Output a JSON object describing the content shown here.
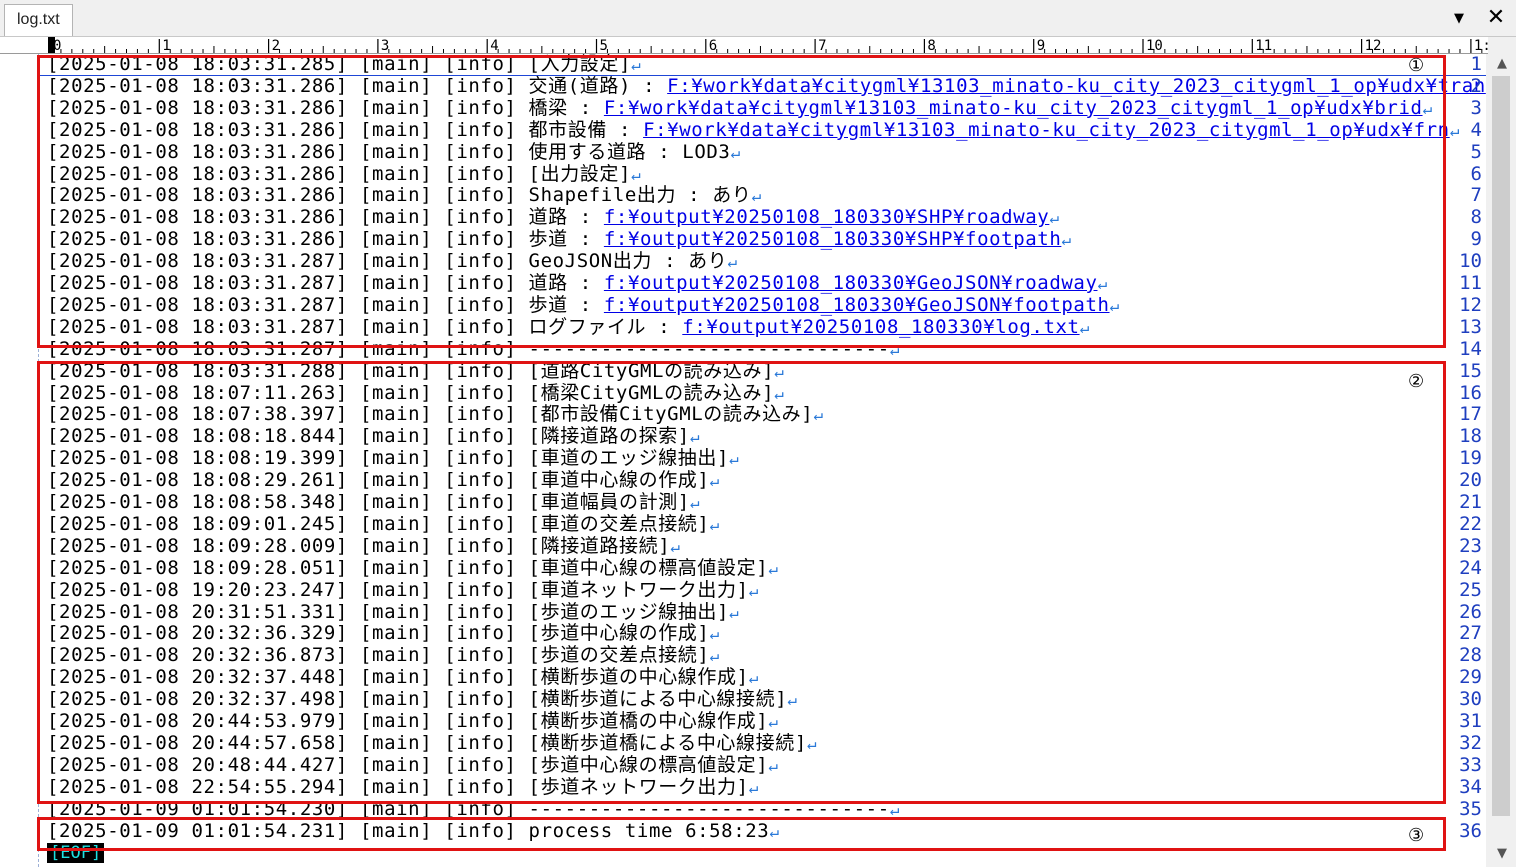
{
  "tab": {
    "label": "log.txt"
  },
  "window": {
    "dropdown_icon": "chevron-down-icon",
    "close_icon": "close-icon",
    "dropdown_glyph": "▼",
    "close_glyph": "✕"
  },
  "ruler": {
    "labels": [
      "0",
      "1",
      "2",
      "3",
      "4",
      "5",
      "6",
      "7",
      "8",
      "9",
      "10",
      "11",
      "12",
      "1:"
    ]
  },
  "return_glyph": "↵",
  "lines": [
    {
      "n": "1",
      "text": "[2025-01-08 18:03:31.285] [main] [info] [入力設定]",
      "link": ""
    },
    {
      "n": "2",
      "text": "[2025-01-08 18:03:31.286] [main] [info] 交通(道路) : ",
      "link": "F:¥work¥data¥citygml¥13103_minato-ku_city_2023_citygml_1_op¥udx¥tran"
    },
    {
      "n": "3",
      "text": "[2025-01-08 18:03:31.286] [main] [info] 橋梁 : ",
      "link": "F:¥work¥data¥citygml¥13103_minato-ku_city_2023_citygml_1_op¥udx¥brid"
    },
    {
      "n": "4",
      "text": "[2025-01-08 18:03:31.286] [main] [info] 都市設備 : ",
      "link": "F:¥work¥data¥citygml¥13103_minato-ku_city_2023_citygml_1_op¥udx¥frn"
    },
    {
      "n": "5",
      "text": "[2025-01-08 18:03:31.286] [main] [info] 使用する道路 : LOD3",
      "link": ""
    },
    {
      "n": "6",
      "text": "[2025-01-08 18:03:31.286] [main] [info] [出力設定]",
      "link": ""
    },
    {
      "n": "7",
      "text": "[2025-01-08 18:03:31.286] [main] [info] Shapefile出力 : あり",
      "link": ""
    },
    {
      "n": "8",
      "text": "[2025-01-08 18:03:31.286] [main] [info] 道路 : ",
      "link": "f:¥output¥20250108_180330¥SHP¥roadway"
    },
    {
      "n": "9",
      "text": "[2025-01-08 18:03:31.286] [main] [info] 歩道 : ",
      "link": "f:¥output¥20250108_180330¥SHP¥footpath"
    },
    {
      "n": "10",
      "text": "[2025-01-08 18:03:31.287] [main] [info] GeoJSON出力 : あり",
      "link": ""
    },
    {
      "n": "11",
      "text": "[2025-01-08 18:03:31.287] [main] [info] 道路 : ",
      "link": "f:¥output¥20250108_180330¥GeoJSON¥roadway"
    },
    {
      "n": "12",
      "text": "[2025-01-08 18:03:31.287] [main] [info] 歩道 : ",
      "link": "f:¥output¥20250108_180330¥GeoJSON¥footpath"
    },
    {
      "n": "13",
      "text": "[2025-01-08 18:03:31.287] [main] [info] ログファイル : ",
      "link": "f:¥output¥20250108_180330¥log.txt"
    },
    {
      "n": "14",
      "text": "[2025-01-08 18:03:31.287] [main] [info] ------------------------------",
      "link": ""
    },
    {
      "n": "15",
      "text": "[2025-01-08 18:03:31.288] [main] [info] [道路CityGMLの読み込み]",
      "link": ""
    },
    {
      "n": "16",
      "text": "[2025-01-08 18:07:11.263] [main] [info] [橋梁CityGMLの読み込み]",
      "link": ""
    },
    {
      "n": "17",
      "text": "[2025-01-08 18:07:38.397] [main] [info] [都市設備CityGMLの読み込み]",
      "link": ""
    },
    {
      "n": "18",
      "text": "[2025-01-08 18:08:18.844] [main] [info] [隣接道路の探索]",
      "link": ""
    },
    {
      "n": "19",
      "text": "[2025-01-08 18:08:19.399] [main] [info] [車道のエッジ線抽出]",
      "link": ""
    },
    {
      "n": "20",
      "text": "[2025-01-08 18:08:29.261] [main] [info] [車道中心線の作成]",
      "link": ""
    },
    {
      "n": "21",
      "text": "[2025-01-08 18:08:58.348] [main] [info] [車道幅員の計測]",
      "link": ""
    },
    {
      "n": "22",
      "text": "[2025-01-08 18:09:01.245] [main] [info] [車道の交差点接続]",
      "link": ""
    },
    {
      "n": "23",
      "text": "[2025-01-08 18:09:28.009] [main] [info] [隣接道路接続]",
      "link": ""
    },
    {
      "n": "24",
      "text": "[2025-01-08 18:09:28.051] [main] [info] [車道中心線の標高値設定]",
      "link": ""
    },
    {
      "n": "25",
      "text": "[2025-01-08 19:20:23.247] [main] [info] [車道ネットワーク出力]",
      "link": ""
    },
    {
      "n": "26",
      "text": "[2025-01-08 20:31:51.331] [main] [info] [歩道のエッジ線抽出]",
      "link": ""
    },
    {
      "n": "27",
      "text": "[2025-01-08 20:32:36.329] [main] [info] [歩道中心線の作成]",
      "link": ""
    },
    {
      "n": "28",
      "text": "[2025-01-08 20:32:36.873] [main] [info] [歩道の交差点接続]",
      "link": ""
    },
    {
      "n": "29",
      "text": "[2025-01-08 20:32:37.448] [main] [info] [横断歩道の中心線作成]",
      "link": ""
    },
    {
      "n": "30",
      "text": "[2025-01-08 20:32:37.498] [main] [info] [横断歩道による中心線接続]",
      "link": ""
    },
    {
      "n": "31",
      "text": "[2025-01-08 20:44:53.979] [main] [info] [横断歩道橋の中心線作成]",
      "link": ""
    },
    {
      "n": "32",
      "text": "[2025-01-08 20:44:57.658] [main] [info] [横断歩道橋による中心線接続]",
      "link": ""
    },
    {
      "n": "33",
      "text": "[2025-01-08 20:48:44.427] [main] [info] [歩道中心線の標高値設定]",
      "link": ""
    },
    {
      "n": "34",
      "text": "[2025-01-08 22:54:55.294] [main] [info] [歩道ネットワーク出力]",
      "link": ""
    },
    {
      "n": "35",
      "text": "[2025-01-09 01:01:54.230] [main] [info] ------------------------------",
      "link": ""
    },
    {
      "n": "36",
      "text": "[2025-01-09 01:01:54.231] [main] [info] process time 6:58:23",
      "link": ""
    }
  ],
  "eof": "[EOF]",
  "markers": [
    "①",
    "②",
    "③"
  ],
  "colors": {
    "highlight_box": "#e01313",
    "line_number": "#1f3fbf",
    "link": "#0000e6",
    "return_mark": "#2a79d8",
    "eof_text": "#1ee0e0"
  },
  "scrollbar": {
    "up_icon": "scroll-up-icon",
    "down_icon": "scroll-down-icon",
    "up_glyph": "▲",
    "down_glyph": "▼"
  }
}
